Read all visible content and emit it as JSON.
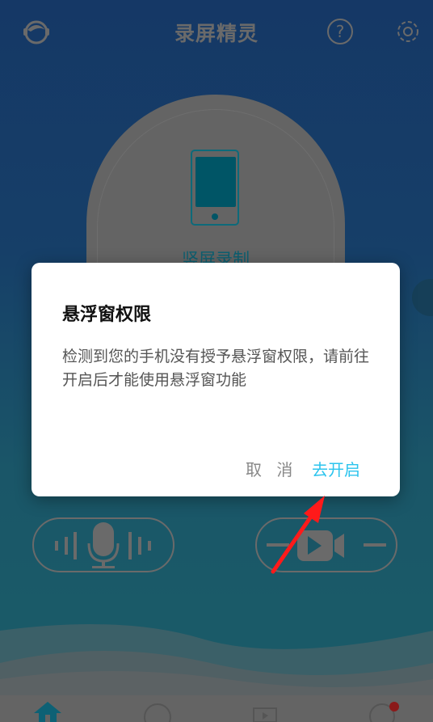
{
  "header": {
    "title": "录屏精灵",
    "icons": [
      "headset-support-icon",
      "help-icon",
      "settings-icon"
    ]
  },
  "main": {
    "record_mode_label": "竖屏录制",
    "record_icon": "phone-portrait-icon",
    "audio_icon": "microphone-icon",
    "video_icon": "video-camera-icon"
  },
  "dialog": {
    "title": "悬浮窗权限",
    "message": "检测到您的手机没有授予悬浮窗权限，请前往开启后才能使用悬浮窗功能",
    "cancel_label": "取 消",
    "confirm_label": "去开启"
  },
  "bottom_nav": {
    "icons": [
      "home-icon",
      "palette-icon",
      "video-tv-icon",
      "edit-palette-icon"
    ],
    "badge_color": "#8b1a1a"
  },
  "colors": {
    "accent": "#2cc4ee",
    "annotation_arrow": "#ff1a1a"
  }
}
